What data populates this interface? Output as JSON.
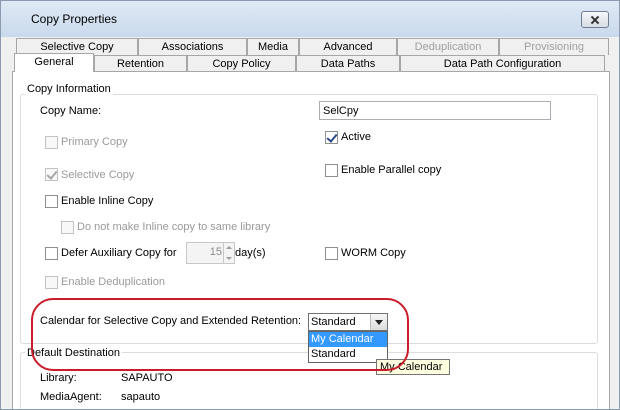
{
  "window": {
    "title": "Copy Properties"
  },
  "tabs_row1": [
    {
      "label": "Selective Copy",
      "disabled": false
    },
    {
      "label": "Associations",
      "disabled": false
    },
    {
      "label": "Media",
      "disabled": false
    },
    {
      "label": "Advanced",
      "disabled": false
    },
    {
      "label": "Deduplication",
      "disabled": true
    },
    {
      "label": "Provisioning",
      "disabled": true
    }
  ],
  "tabs_row2": [
    {
      "label": "General",
      "active": true
    },
    {
      "label": "Retention",
      "active": false
    },
    {
      "label": "Copy Policy",
      "active": false
    },
    {
      "label": "Data Paths",
      "active": false
    },
    {
      "label": "Data Path Configuration",
      "active": false
    }
  ],
  "copy_info": {
    "legend": "Copy Information",
    "copy_name_label": "Copy Name:",
    "copy_name_value": "SelCpy",
    "primary_copy": {
      "label": "Primary Copy",
      "checked": false,
      "enabled": false
    },
    "active": {
      "label": "Active",
      "checked": true,
      "enabled": true
    },
    "selective_copy": {
      "label": "Selective Copy",
      "checked": true,
      "enabled": false
    },
    "enable_parallel": {
      "label": "Enable Parallel copy",
      "checked": false,
      "enabled": true
    },
    "enable_inline": {
      "label": "Enable Inline Copy",
      "checked": false,
      "enabled": true
    },
    "no_inline_same_lib": {
      "label": "Do not make Inline copy to same library",
      "checked": false,
      "enabled": false
    },
    "defer_aux": {
      "label": "Defer Auxiliary Copy for",
      "checked": false,
      "enabled": true,
      "days": "15",
      "days_label": "day(s)"
    },
    "worm": {
      "label": "WORM Copy",
      "checked": false,
      "enabled": true
    },
    "dedup": {
      "label": "Enable Deduplication",
      "checked": false,
      "enabled": false
    },
    "calendar_label": "Calendar for Selective Copy and Extended Retention:",
    "calendar_value": "Standard",
    "calendar_options": [
      "My Calendar",
      "Standard"
    ],
    "highlighted_option": "My Calendar",
    "tooltip": "My Calendar"
  },
  "default_destination": {
    "legend": "Default Destination",
    "library_label": "Library:",
    "library_value": "SAPAUTO",
    "media_agent_label": "MediaAgent:",
    "media_agent_value": "sapauto"
  },
  "colors": {
    "highlight_ring": "#c91d2b",
    "selection": "#3399ff",
    "tooltip_bg": "#ffffe1"
  }
}
